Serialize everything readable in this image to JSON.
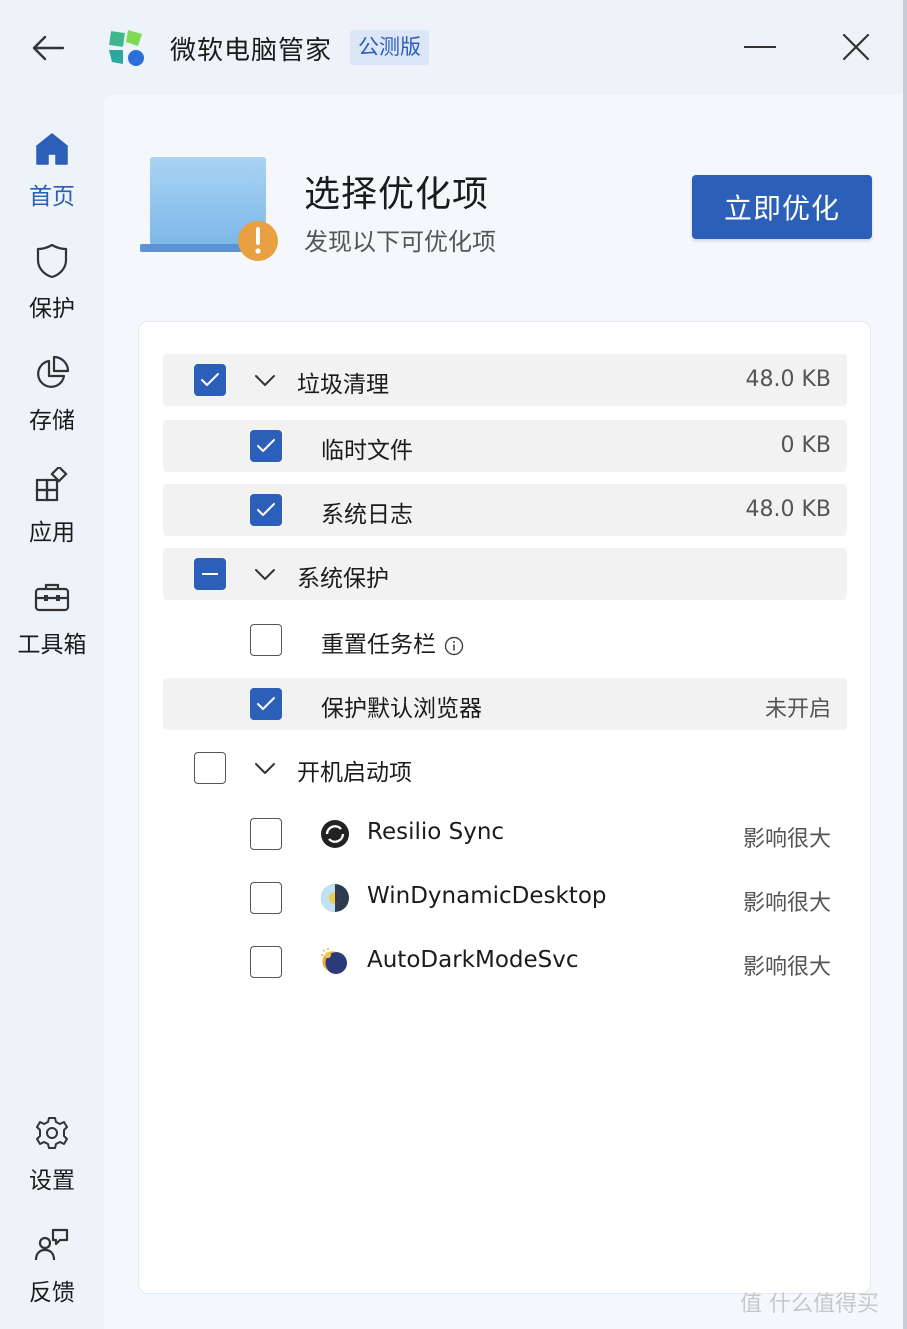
{
  "app": {
    "title": "微软电脑管家",
    "badge": "公测版"
  },
  "sidebar": {
    "items": [
      {
        "label": "首页",
        "icon": "home-icon",
        "active": true
      },
      {
        "label": "保护",
        "icon": "shield-icon",
        "active": false
      },
      {
        "label": "存储",
        "icon": "pie-chart-icon",
        "active": false
      },
      {
        "label": "应用",
        "icon": "apps-icon",
        "active": false
      },
      {
        "label": "工具箱",
        "icon": "toolbox-icon",
        "active": false
      }
    ],
    "bottom_items": [
      {
        "label": "设置",
        "icon": "gear-icon"
      },
      {
        "label": "反馈",
        "icon": "feedback-icon"
      }
    ]
  },
  "hero": {
    "title": "选择优化项",
    "subtitle": "发现以下可优化项",
    "button": "立即优化"
  },
  "colors": {
    "accent": "#2c5fb8",
    "warning": "#e8a040"
  },
  "groups": [
    {
      "label": "垃圾清理",
      "value": "48.0 KB",
      "state": "checked",
      "items": [
        {
          "label": "临时文件",
          "value": "0 KB",
          "state": "checked"
        },
        {
          "label": "系统日志",
          "value": "48.0 KB",
          "state": "checked"
        }
      ]
    },
    {
      "label": "系统保护",
      "value": "",
      "state": "mixed",
      "items": [
        {
          "label": "重置任务栏",
          "value": "",
          "state": "unchecked",
          "info": true
        },
        {
          "label": "保护默认浏览器",
          "value": "未开启",
          "state": "checked"
        }
      ]
    },
    {
      "label": "开机启动项",
      "value": "",
      "state": "unchecked",
      "items": [
        {
          "label": "Resilio Sync",
          "value": "影响很大",
          "state": "unchecked",
          "icon": "resilio-sync-icon"
        },
        {
          "label": "WinDynamicDesktop",
          "value": "影响很大",
          "state": "unchecked",
          "icon": "windynamicdesktop-icon"
        },
        {
          "label": "AutoDarkModeSvc",
          "value": "影响很大",
          "state": "unchecked",
          "icon": "autodarkmode-icon"
        }
      ]
    }
  ],
  "watermark": "值 什么值得买"
}
